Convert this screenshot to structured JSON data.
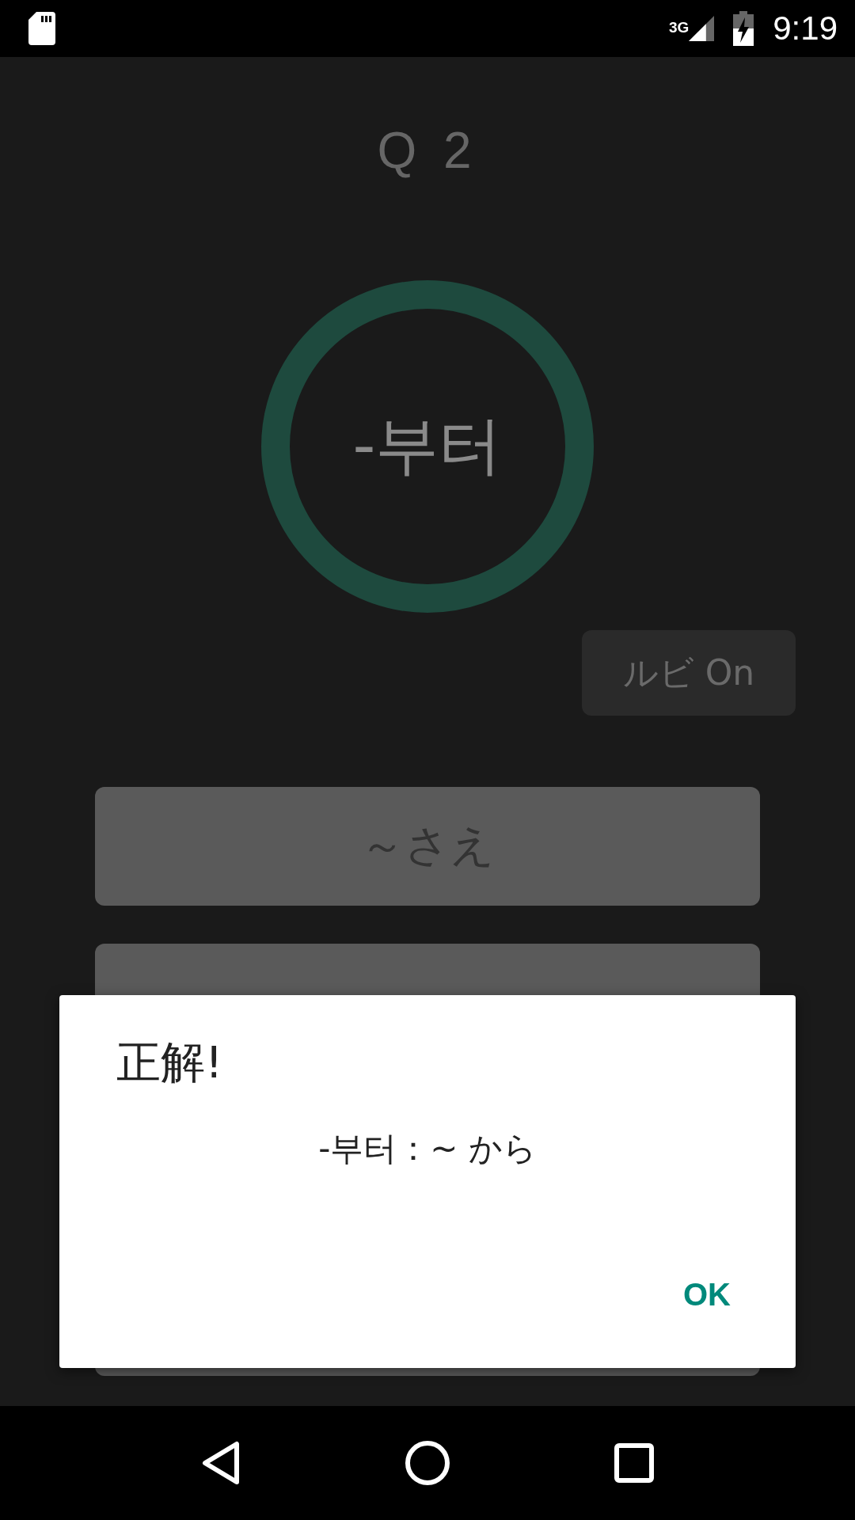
{
  "status_bar": {
    "network": "3G",
    "time": "9:19"
  },
  "question": {
    "number": "Q 2",
    "word": "-부터"
  },
  "ruby_button": {
    "label": "ルビ On"
  },
  "options": [
    {
      "label": "～さえ"
    }
  ],
  "dialog": {
    "title": "正解!",
    "message": "-부터：~ から",
    "button": "OK"
  }
}
